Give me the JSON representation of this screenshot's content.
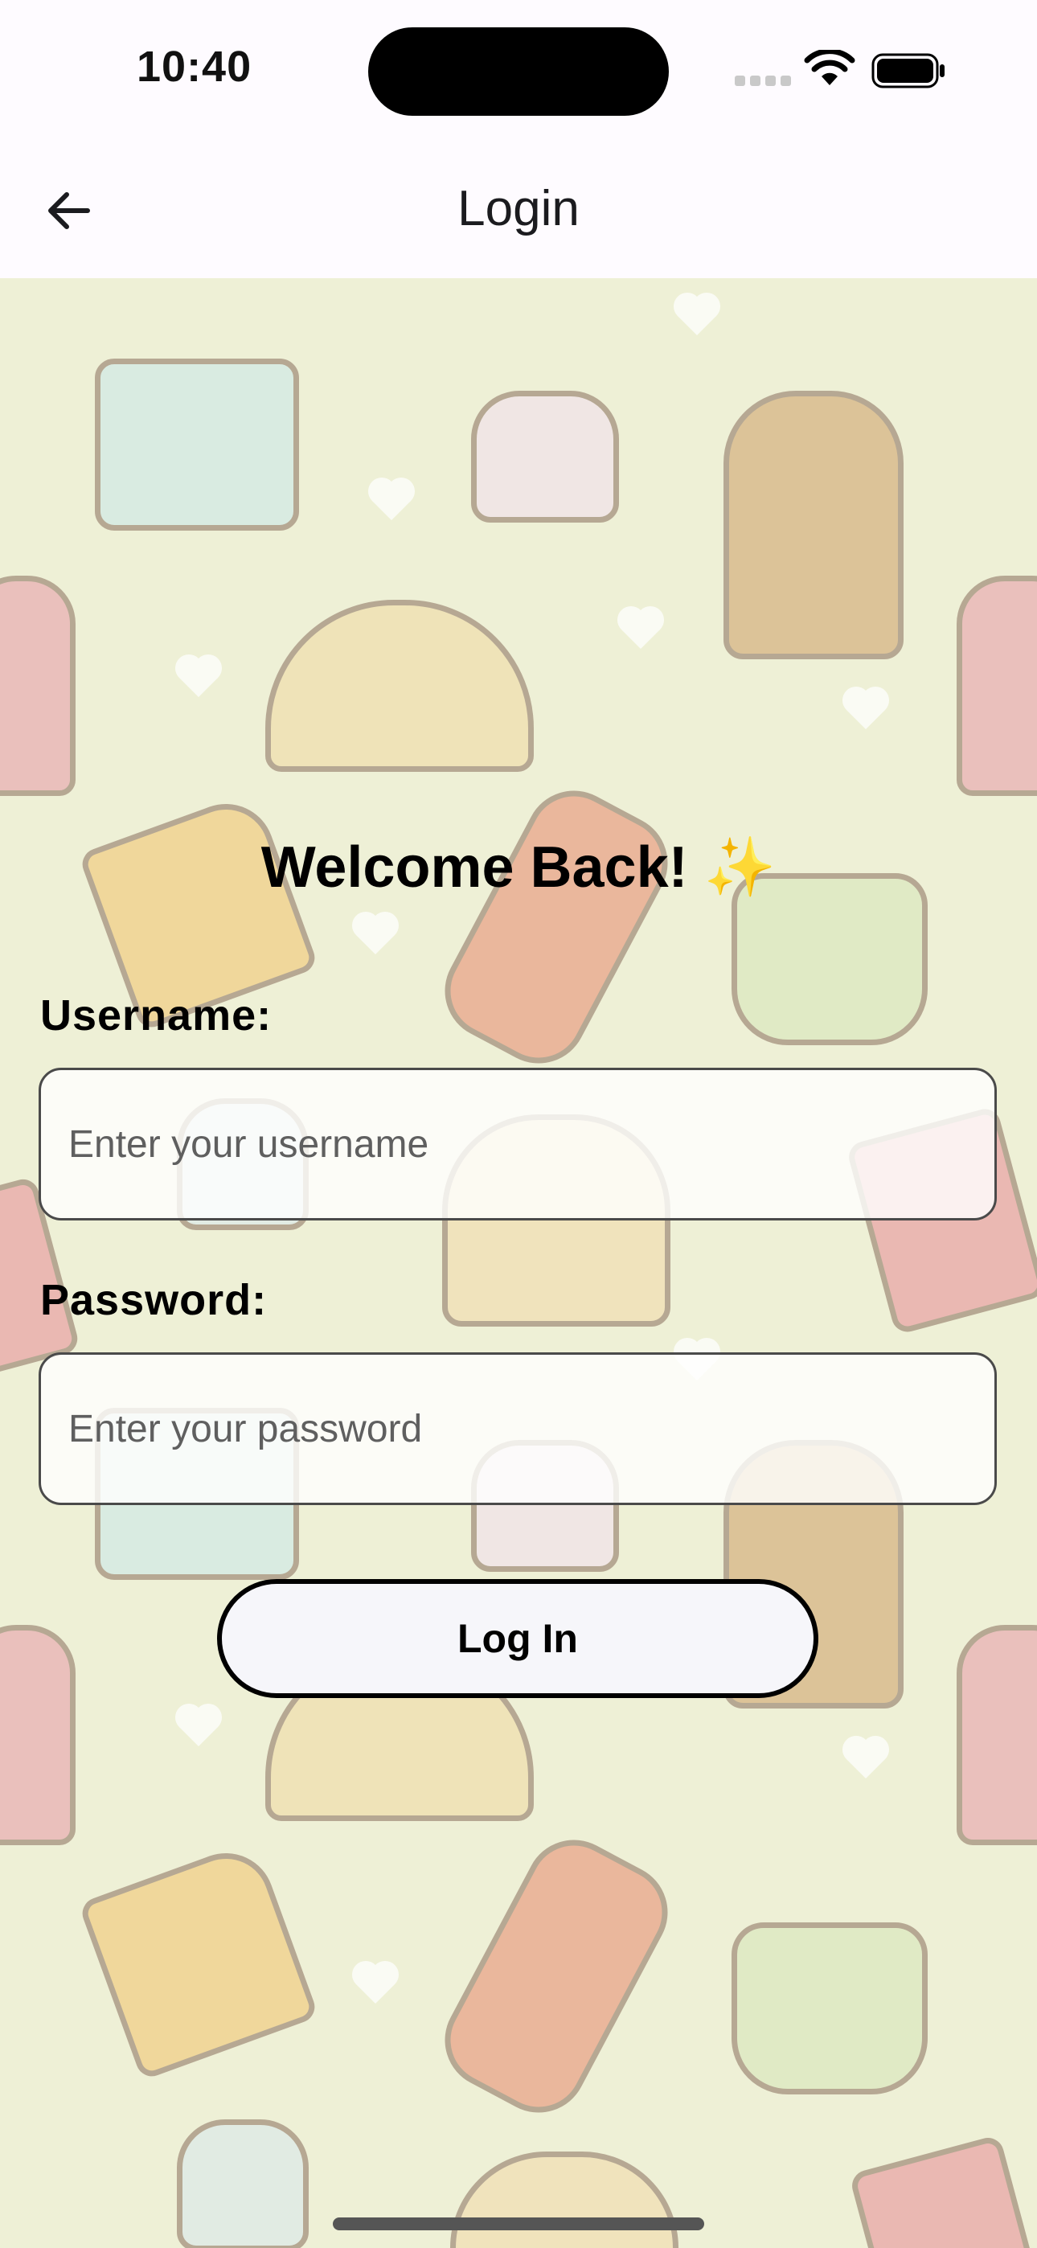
{
  "status_bar": {
    "time": "10:40"
  },
  "app_bar": {
    "title": "Login",
    "back_icon": "arrow-left-icon"
  },
  "login_form": {
    "heading": "Welcome Back! ✨",
    "username_label": "Username:",
    "username_placeholder": "Enter your username",
    "username_value": "",
    "password_label": "Password:",
    "password_placeholder": "Enter your password",
    "password_value": "",
    "submit_label": "Log In"
  },
  "colors": {
    "background": "#eef0d6",
    "app_bar": "#fefbff",
    "button_fill": "#f6f6fa",
    "border": "#000000"
  }
}
